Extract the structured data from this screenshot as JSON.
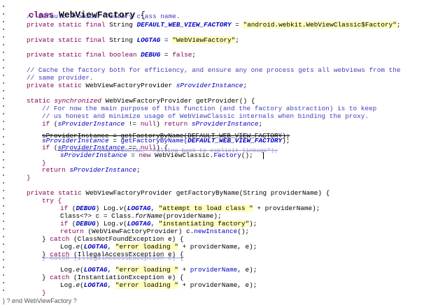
{
  "code_lines": [
    {
      "text": "class WebViewFactory {",
      "indent": 0
    },
    {
      "text": "// Default Provider factory class name.",
      "indent": 1
    },
    {
      "text": "private static final String DEFAULT_WEB_VIEW_FACTORY = \"android.webkit.WebViewClassic$Factory\";",
      "indent": 1
    },
    {
      "text": "private static final String LOGTAG = \"WebViewFactory\";",
      "indent": 1
    },
    {
      "text": "private static final boolean DEBUG = false;",
      "indent": 1
    },
    {
      "text": "// Cache the factory both for efficiency, and ensure any one process gets all webviews from the",
      "indent": 1
    },
    {
      "text": "// same provider.",
      "indent": 1
    },
    {
      "text": "private static WebViewFactoryProvider sProviderInstance;",
      "indent": 1
    },
    {
      "text": "static synchronized WebViewFactoryProvider getProvider() {",
      "indent": 1
    },
    {
      "text": "// For now the main purpose of this function (and the factory abstraction) is to keep",
      "indent": 2
    },
    {
      "text": "// us honest and minimize usage of WebViewClassic internals when binding the proxy.",
      "indent": 2
    },
    {
      "text": "if (sProviderInstance != null) return sProviderInstance;",
      "indent": 2
    },
    {
      "text": "sProviderInstance = getFactoryByName(DEFAULT_WEB_VIEW_FACTORY);",
      "indent": 2
    },
    {
      "text": "sProviderInstance = getFactoryByName(DEFAULT_WEB_VIEW_FACTORY);",
      "indent": 2
    },
    {
      "text": "if (sProviderInstance == null) {",
      "indent": 2
    },
    {
      "text": "if (DEBUG) Log.v(LOGTAG, \"Falling back to explicit linkage\");",
      "indent": 3
    },
    {
      "text": "sProviderInstance = new WebViewClassic.Factory();",
      "indent": 3
    },
    {
      "text": "}",
      "indent": 2
    },
    {
      "text": "return sProviderInstance;",
      "indent": 2
    },
    {
      "text": "}",
      "indent": 1
    },
    {
      "text": "private static WebViewFactoryProvider getFactoryByName(String providerName) {",
      "indent": 1
    },
    {
      "text": "try {",
      "indent": 2
    },
    {
      "text": "if (DEBUG) Log.v(LOGTAG, \"attempt to load class \" + providerName);",
      "indent": 3
    },
    {
      "text": "Class<?> c = Class.forName(providerName);",
      "indent": 3
    },
    {
      "text": "if (DEBUG) Log.v(LOGTAG, \"instantiating factory\");",
      "indent": 3
    },
    {
      "text": "return (WebViewFactoryProvider) c.newInstance();",
      "indent": 3
    },
    {
      "text": "} catch (ClassNotFoundException e) {",
      "indent": 2
    },
    {
      "text": "Log.e(LOGTAG, \"error loading \" + providerName, e);",
      "indent": 3
    },
    {
      "text": "} catch (IllegalAccessException e) {",
      "indent": 2
    },
    {
      "text": "} catch (IllegalAccessException e) {",
      "indent": 2
    },
    {
      "text": "Log.e(LOGTAG, \"error loading \" + providerName, e);",
      "indent": 3
    },
    {
      "text": "} catch (InstantiationException e) {",
      "indent": 2
    },
    {
      "text": "Log.e(LOGTAG, \"error loading \" + providerName, e);",
      "indent": 3
    },
    {
      "text": "}",
      "indent": 2
    },
    {
      "text": "return null;",
      "indent": 2
    },
    {
      "text": "}",
      "indent": 1
    }
  ],
  "footer": "} ? end WebViewFactory ?",
  "colors": {
    "keyword": "#7f0055",
    "comment": "#3f3fbf",
    "field": "#0000c0",
    "string_background": "#ffffc0"
  }
}
